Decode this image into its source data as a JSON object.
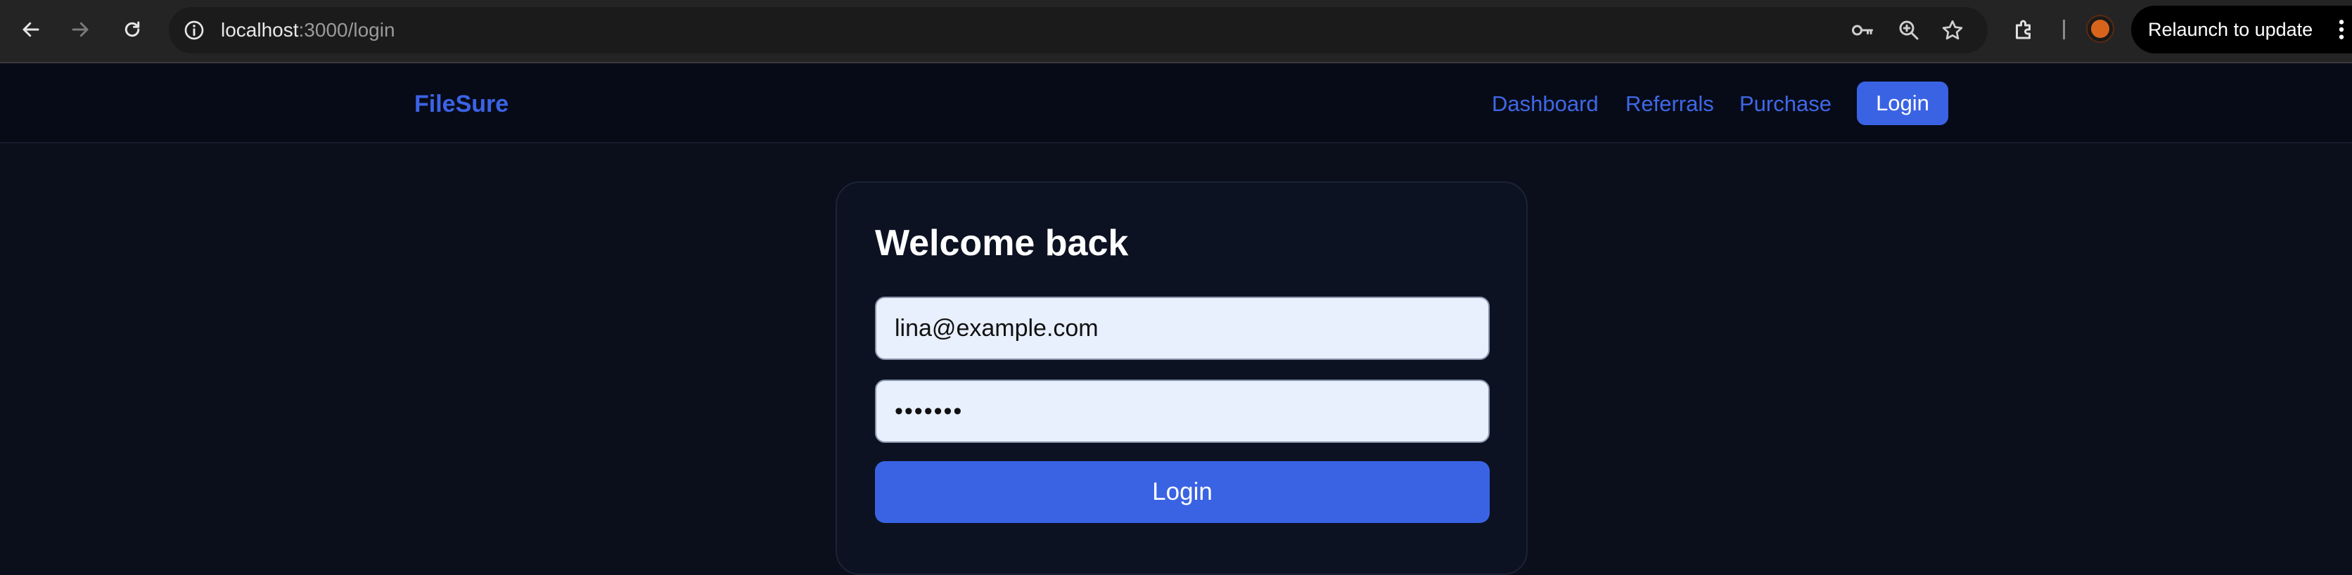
{
  "browser": {
    "url_host": "localhost",
    "url_path": ":3000/login",
    "relaunch_label": "Relaunch to update"
  },
  "navbar": {
    "brand": "FileSure",
    "links": [
      "Dashboard",
      "Referrals",
      "Purchase"
    ],
    "login_label": "Login"
  },
  "login_card": {
    "title": "Welcome back",
    "email_value": "lina@example.com",
    "password_value": "•••••••",
    "submit_label": "Login"
  },
  "colors": {
    "accent": "#3a63e4",
    "page_bg": "#0b0f1c",
    "card_bg": "#0d1222",
    "input_bg": "#e8effd"
  },
  "icons": [
    "back-arrow-icon",
    "forward-arrow-icon",
    "reload-icon",
    "info-icon",
    "key-icon",
    "zoom-icon",
    "star-icon",
    "extensions-icon",
    "kebab-menu-icon"
  ]
}
